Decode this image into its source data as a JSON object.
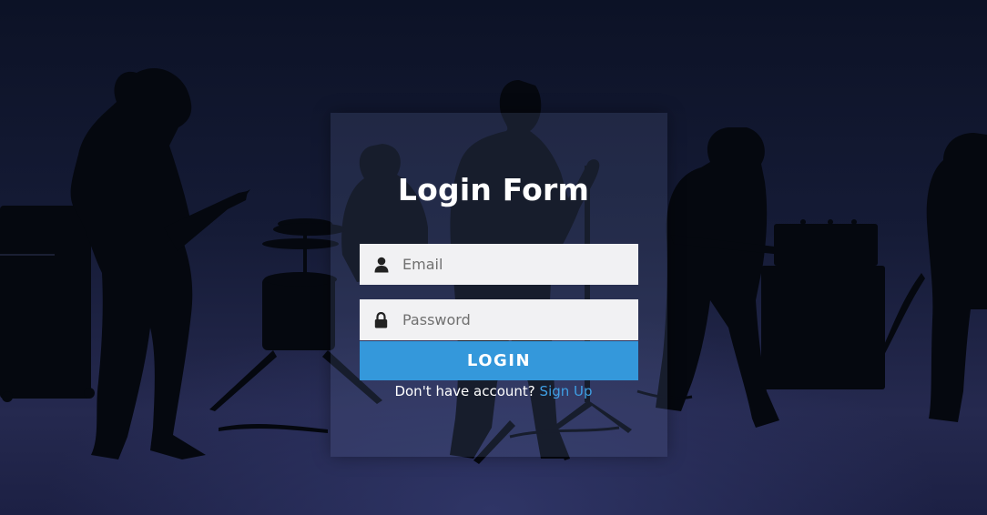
{
  "form": {
    "title": "Login Form",
    "email": {
      "placeholder": "Email",
      "value": ""
    },
    "password": {
      "placeholder": "Password",
      "value": ""
    },
    "login_label": "LOGIN",
    "signup_prompt": "Don't have account?",
    "signup_link": "Sign Up"
  },
  "icons": {
    "email": "user-icon",
    "password": "lock-icon"
  },
  "colors": {
    "accent": "#3498db",
    "link": "#3f9fe3",
    "field_bg": "#f1f1f3",
    "title": "#ffffff",
    "background": "#151b36"
  }
}
